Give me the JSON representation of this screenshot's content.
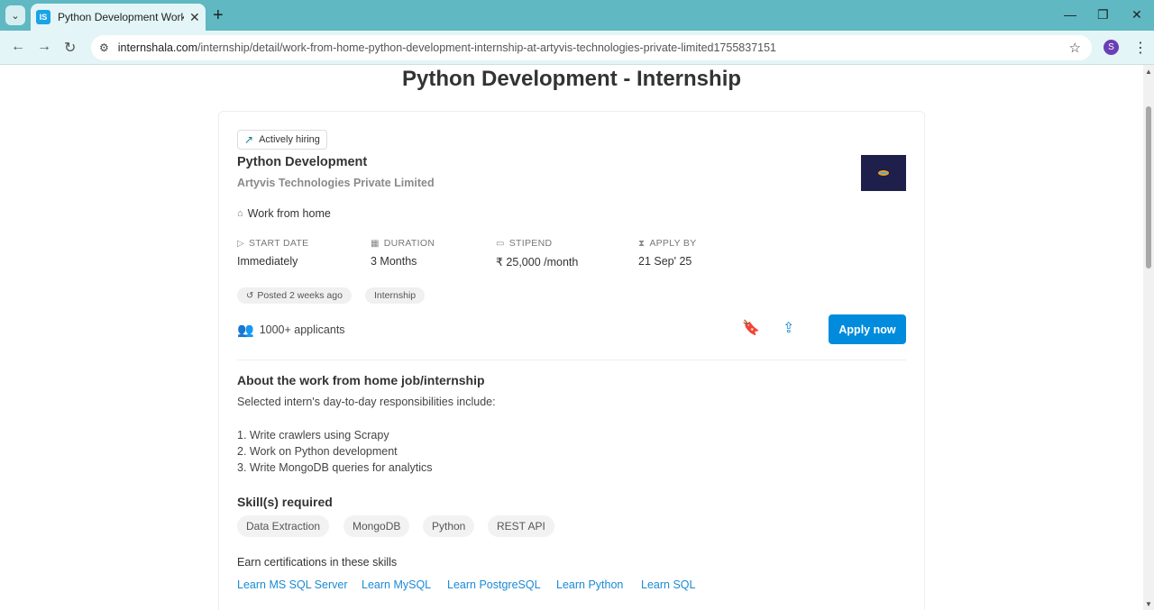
{
  "browser": {
    "tab_title": "Python Development Work From",
    "favicon_text": "IS",
    "url_domain": "internshala.com",
    "url_path": "/internship/detail/work-from-home-python-development-internship-at-artyvis-technologies-private-limited1755837151",
    "profile_initial": "S"
  },
  "page": {
    "title": "Python Development - Internship"
  },
  "job": {
    "badge": "Actively hiring",
    "title": "Python Development",
    "company": "Artyvis Technologies Private Limited",
    "location": "Work from home",
    "details": [
      {
        "label": "START DATE",
        "value": "Immediately",
        "icon": "play-circle-icon"
      },
      {
        "label": "DURATION",
        "value": "3 Months",
        "icon": "calendar-icon"
      },
      {
        "label": "STIPEND",
        "value": "₹ 25,000 /month",
        "icon": "money-icon"
      },
      {
        "label": "APPLY BY",
        "value": "21 Sep' 25",
        "icon": "hourglass-icon"
      }
    ],
    "chips": [
      "Posted 2 weeks ago",
      "Internship"
    ],
    "applicants": "1000+ applicants",
    "apply_label": "Apply now"
  },
  "about": {
    "title": "About the work from home job/internship",
    "intro": "Selected intern's day-to-day responsibilities include:",
    "responsibilities": [
      "1. Write crawlers using Scrapy",
      "2. Work on Python development",
      "3. Write MongoDB queries for analytics"
    ]
  },
  "skills": {
    "title": "Skill(s) required",
    "items": [
      "Data Extraction",
      "MongoDB",
      "Python",
      "REST API"
    ]
  },
  "certifications": {
    "title": "Earn certifications in these skills",
    "links": [
      "Learn MS SQL Server",
      "Learn MySQL",
      "Learn PostgreSQL",
      "Learn Python",
      "Learn SQL"
    ]
  },
  "colors": {
    "accent": "#008bdc",
    "link": "#1a8ad4",
    "chrome": "#5fb8c2"
  }
}
